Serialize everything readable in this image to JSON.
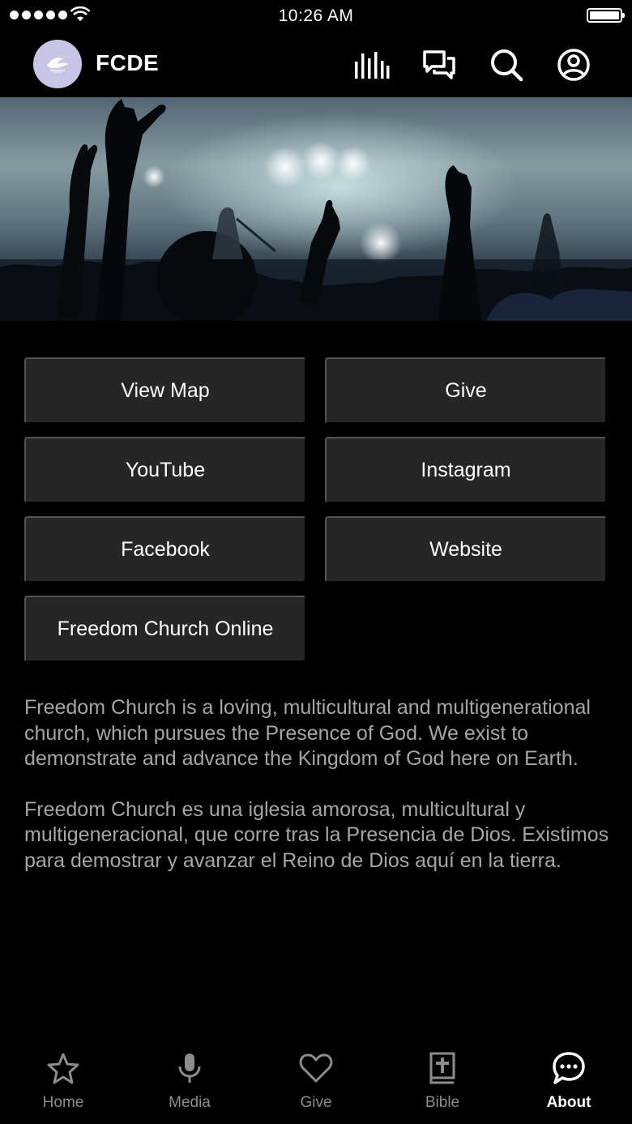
{
  "status_bar": {
    "time": "10:26 AM"
  },
  "header": {
    "brand": "FCDE",
    "icons": [
      "bar-chart-icon",
      "chat-icon",
      "search-icon",
      "account-icon"
    ]
  },
  "buttons": [
    {
      "label": "View Map"
    },
    {
      "label": "Give"
    },
    {
      "label": "YouTube"
    },
    {
      "label": "Instagram"
    },
    {
      "label": "Facebook"
    },
    {
      "label": "Website"
    },
    {
      "label": "Freedom Church Online"
    }
  ],
  "description": [
    "Freedom Church is a loving, multicultural and multigenerational church,  which pursues the Presence of God. We exist to demonstrate and advance the Kingdom of God here on Earth.",
    "Freedom Church es una iglesia amorosa, multicultural y multigeneracional, que corre tras la Presencia de Dios. Existimos para demostrar y avanzar el Reino de Dios aquí en la tierra."
  ],
  "tabs": [
    {
      "label": "Home",
      "icon": "star-icon"
    },
    {
      "label": "Media",
      "icon": "microphone-icon"
    },
    {
      "label": "Give",
      "icon": "heart-icon"
    },
    {
      "label": "Bible",
      "icon": "bible-icon"
    },
    {
      "label": "About",
      "icon": "speech-bubble-icon",
      "active": true
    }
  ],
  "colors": {
    "background": "#000000",
    "button": "#262626",
    "description_text": "#a6a6a6",
    "tab_inactive": "#8c8c8c",
    "tab_active": "#ffffff",
    "logo_bg": "#c7c5e5"
  }
}
